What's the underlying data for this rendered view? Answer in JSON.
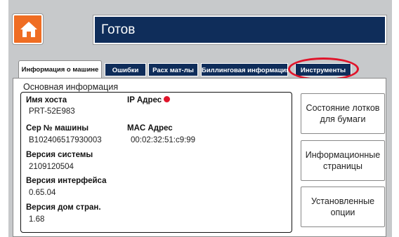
{
  "header": {
    "home_icon": "home-icon",
    "status_title": "Готов"
  },
  "tabs": [
    {
      "label": "Информация о машине",
      "active": true
    },
    {
      "label": "Ошибки",
      "active": false
    },
    {
      "label": "Расх мат-лы",
      "active": false
    },
    {
      "label": "Биллинговая информация",
      "active": false
    },
    {
      "label": "Инструменты",
      "active": false
    }
  ],
  "annotation": {
    "highlight_color": "#e0142a"
  },
  "main": {
    "section_title": "Основная информация",
    "fields": {
      "host_name": {
        "label": "Имя хоста",
        "value": "PRT-52E983"
      },
      "ip_address": {
        "label": "IP Адрес",
        "value": "",
        "status_color": "#e0142a"
      },
      "serial": {
        "label": "Сер № машины",
        "value": "B102406517930003"
      },
      "mac_address": {
        "label": "MAC Адрес",
        "value": "00:02:32:51:c9:99"
      },
      "system_version": {
        "label": "Версия системы",
        "value": "2109120504"
      },
      "interface_version": {
        "label": "Версия интерфейса",
        "value": "0.65.04"
      },
      "home_page_version": {
        "label": "Версия дом стран.",
        "value": "1.68"
      }
    }
  },
  "side_buttons": [
    {
      "label": "Состояние лотков для бумаги"
    },
    {
      "label": "Информационные страницы"
    },
    {
      "label": "Установленные опции"
    }
  ],
  "colors": {
    "accent_orange": "#ef6d23",
    "header_navy": "#0f2d5a",
    "panel_gray": "#c7c9cb"
  }
}
